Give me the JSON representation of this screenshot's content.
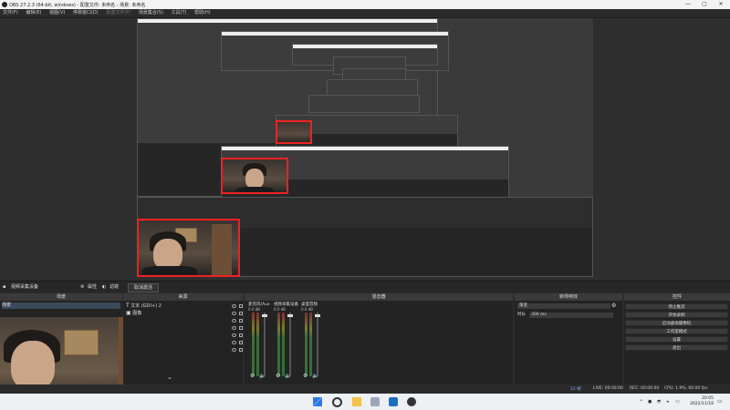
{
  "window": {
    "title": "OBS 27.2.3 (64-bit, windows) - 配置文件: 未命名 - 场景: 未命名",
    "min_label": "—",
    "max_label": "▢",
    "close_label": "✕"
  },
  "menu": [
    "文件(F)",
    "编辑(E)",
    "视图(V)",
    "停靠窗口(D)",
    "配置文件(P)",
    "场景集合(S)",
    "工具(T)",
    "帮助(H)"
  ],
  "toolbar": {
    "source_label": "视频采集设备",
    "properties_label": "属性",
    "filters_label": "滤镜",
    "deactivate_label": "取消激活"
  },
  "scenes": {
    "header": "场景",
    "items": [
      "场景"
    ]
  },
  "sources": {
    "header": "来源",
    "items": [
      {
        "name": "文本 (GDI+) 2",
        "kind": "text"
      },
      {
        "name": "图像",
        "kind": "image"
      }
    ]
  },
  "mixer": {
    "header": "混音器",
    "channels": [
      {
        "name": "麦克风/Aux",
        "db": "0.0 dB"
      },
      {
        "name": "视频采集设备",
        "db": "0.0 dB"
      },
      {
        "name": "桌面音频",
        "db": "0.0 dB"
      }
    ]
  },
  "transitions": {
    "header": "转场特效",
    "type": "渐变",
    "duration_label": "时长",
    "duration_value": "300 ms"
  },
  "controls": {
    "header": "控件",
    "buttons": [
      "停止推流",
      "开始录制",
      "启动虚拟摄像机",
      "工作室模式",
      "设置",
      "退出"
    ]
  },
  "status": {
    "dropped": "12 帧",
    "live": "LIVE: 00:00:00",
    "rec": "REC: 00:00:00",
    "cpu": "CPU: 1.9%, 60.00 fps"
  },
  "clock": {
    "time": "20:05",
    "date": "2022/11/18"
  },
  "colors": {
    "accent": "#e22222",
    "panel": "#2b2b2b",
    "meter_green": "#3b7a3b"
  }
}
